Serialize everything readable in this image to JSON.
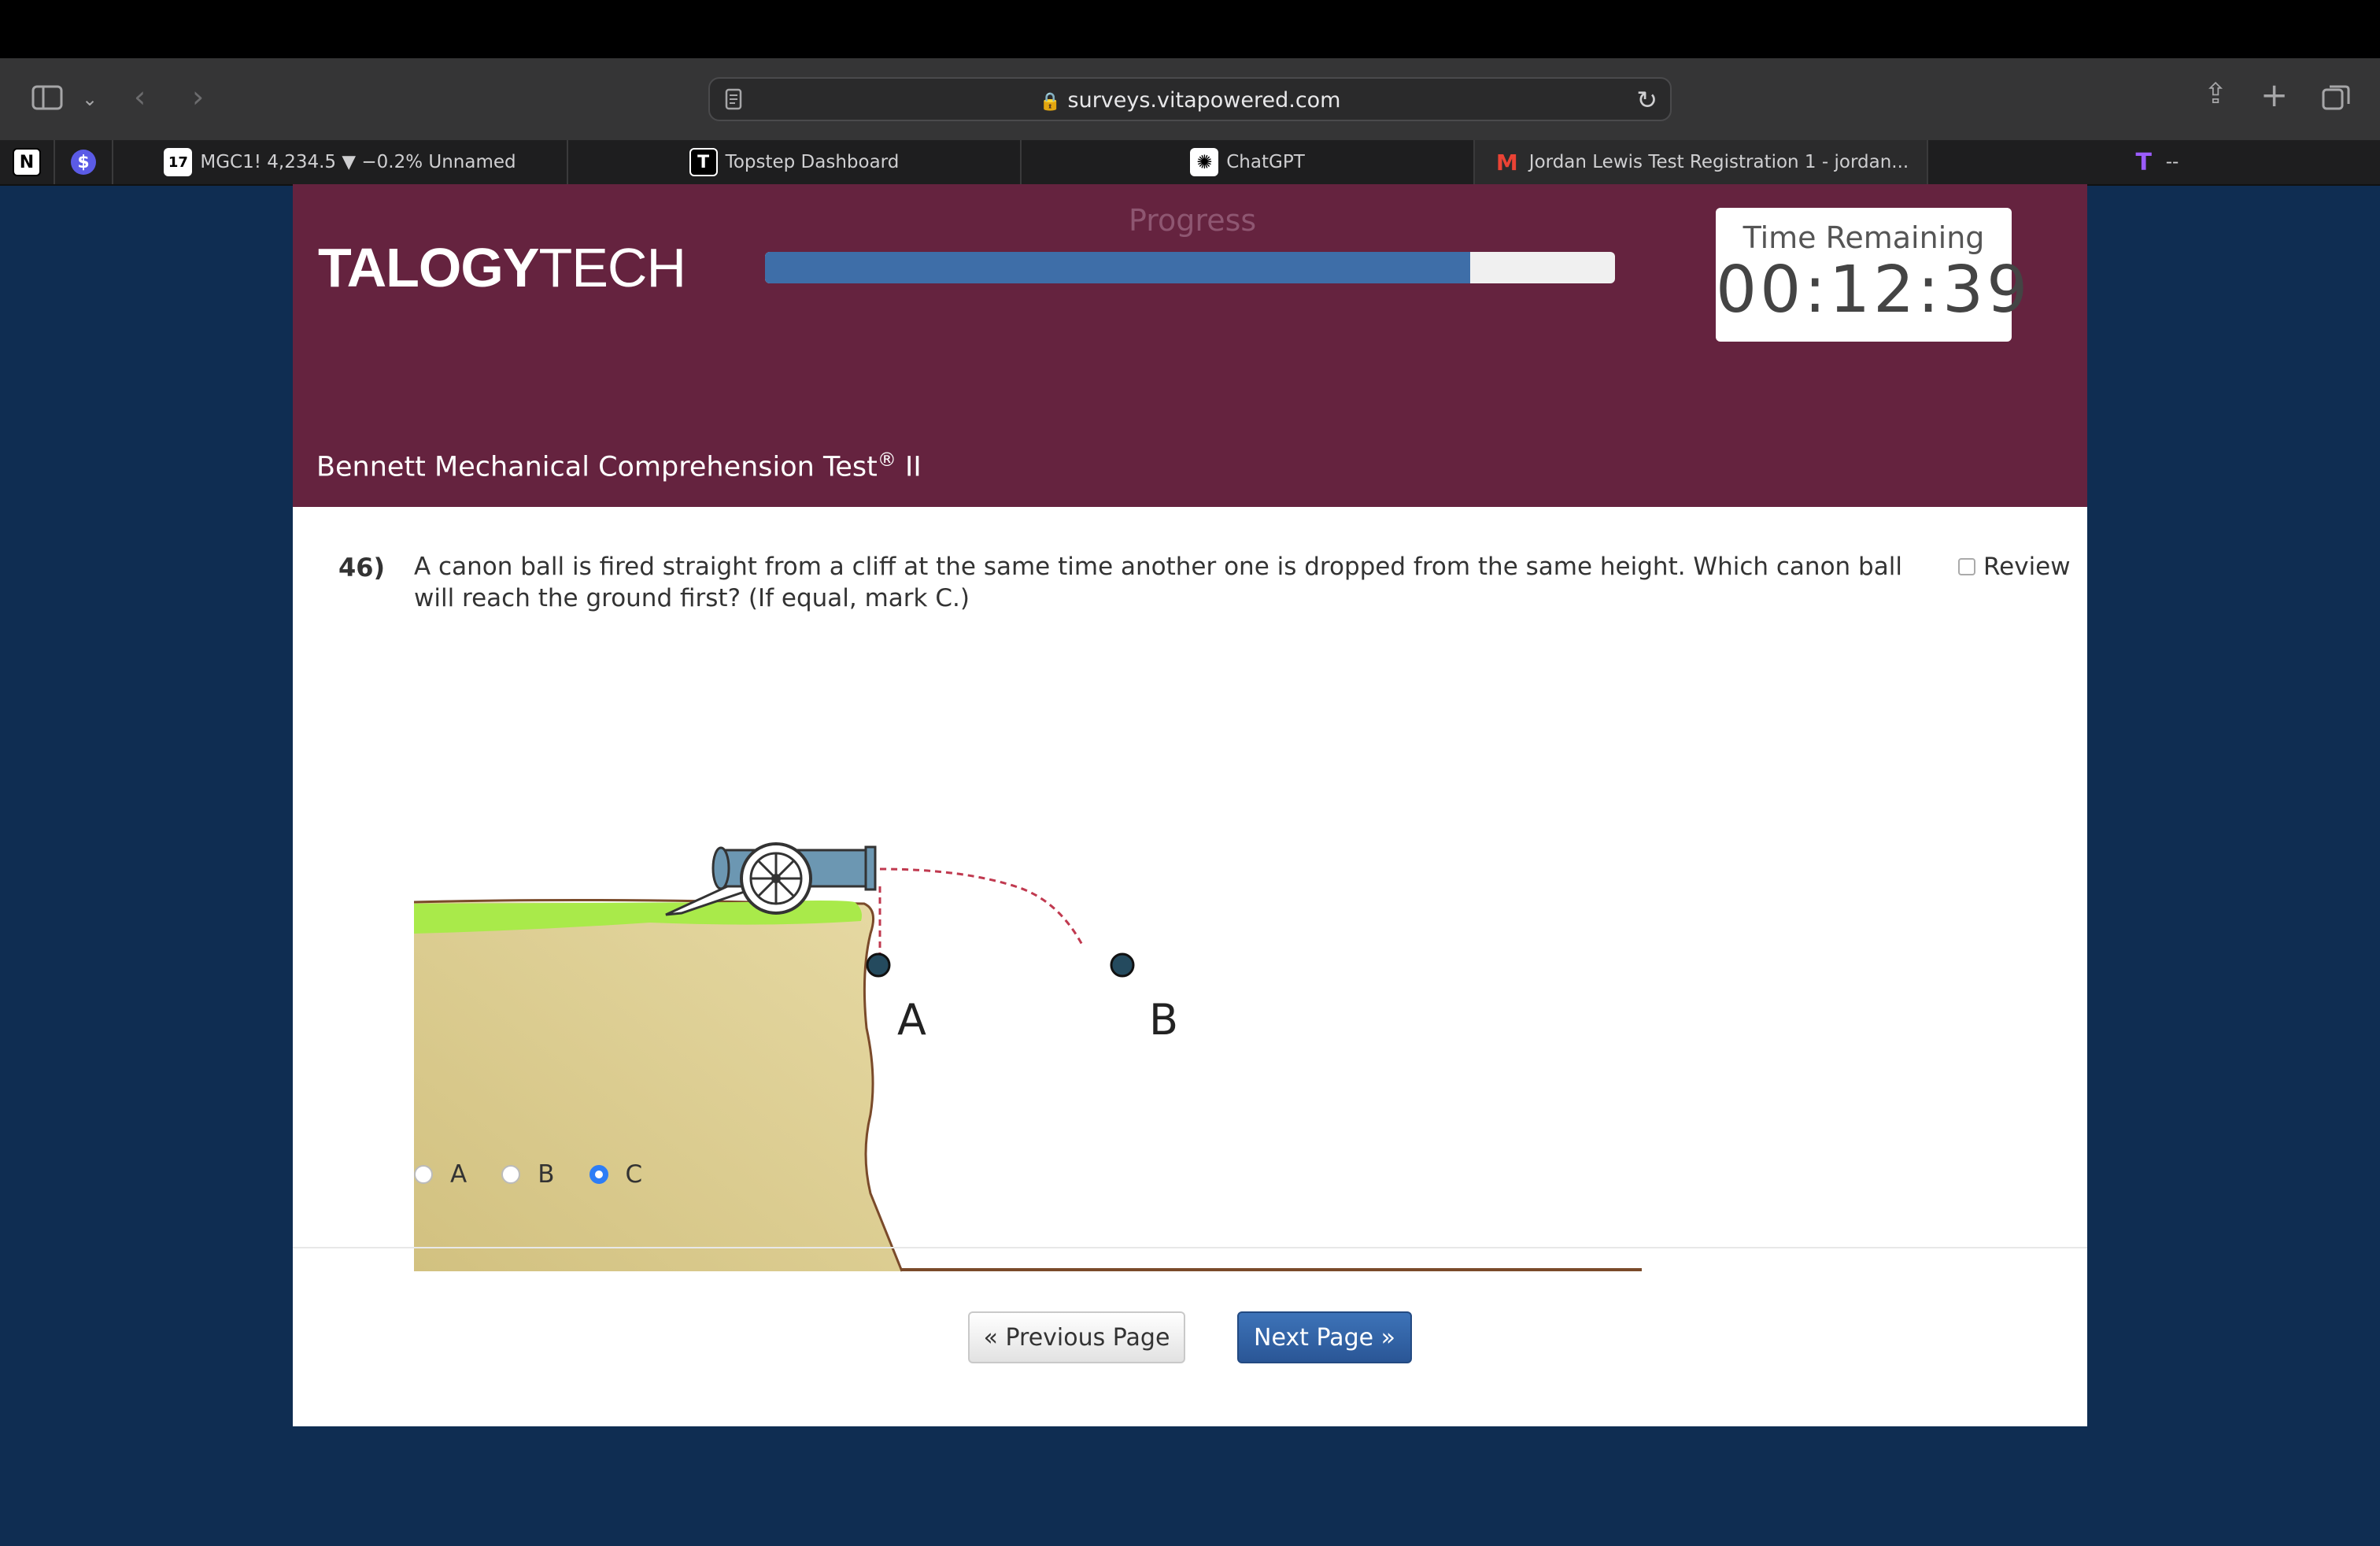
{
  "browser": {
    "url": "surveys.vitapowered.com",
    "tabs": [
      {
        "icon": "tradingview-icon",
        "label": "MGC1! 4,234.5 ▼ −0.2% Unnamed"
      },
      {
        "icon": "topstep-icon",
        "label": "Topstep Dashboard"
      },
      {
        "icon": "chatgpt-icon",
        "label": "ChatGPT"
      },
      {
        "icon": "gmail-icon",
        "label": "Jordan Lewis Test Registration 1 - jordan..."
      },
      {
        "icon": "t-icon",
        "label": "--"
      }
    ],
    "pinned": [
      {
        "icon": "notion-icon",
        "glyph": "N"
      },
      {
        "icon": "dollar-icon",
        "glyph": "$"
      }
    ]
  },
  "header": {
    "logo_bold": "TALOGY",
    "logo_light": "TECH",
    "progress_label": "Progress",
    "progress_fraction": 0.83,
    "timer_label": "Time Remaining",
    "timer_value": "00:12:39",
    "test_title": "Bennett Mechanical Comprehension Test",
    "test_title_sup": "®",
    "test_title_suffix": "II"
  },
  "question": {
    "number": "46)",
    "text": "A canon ball is fired straight from a cliff at the same time another one is dropped from the same height. Which canon ball will reach the ground first? (If equal, mark C.)",
    "review_label": "Review",
    "figure_labels": {
      "a": "A",
      "b": "B"
    },
    "options": [
      {
        "label": "A",
        "selected": false
      },
      {
        "label": "B",
        "selected": false
      },
      {
        "label": "C",
        "selected": true
      }
    ]
  },
  "nav": {
    "prev_label": "« Previous Page",
    "next_label": "Next Page »"
  },
  "colors": {
    "header_bg": "#65233f",
    "page_bg": "#0f2d52",
    "progress_fill": "#3e6ea8",
    "next_button": "#2a5696",
    "radio_selected": "#2d7df6"
  }
}
